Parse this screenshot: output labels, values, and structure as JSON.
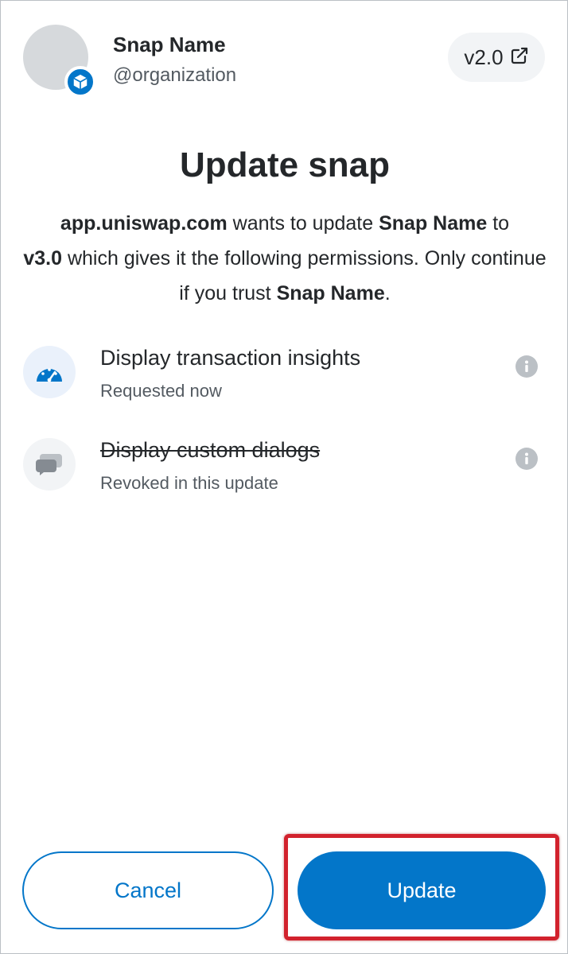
{
  "header": {
    "snap_name": "Snap Name",
    "organization": "@organization",
    "version": "v2.0",
    "version_icon": "external-link-icon",
    "badge_icon": "snap-box-icon"
  },
  "title": "Update snap",
  "description": {
    "origin": "app.uniswap.com",
    "part1": " wants to update ",
    "snap_name": "Snap Name",
    "part2": " to ",
    "new_version": "v3.0",
    "part3": " which gives it the following permissions. Only continue if you trust ",
    "snap_name_2": "Snap Name",
    "part4": "."
  },
  "permissions": [
    {
      "label": "Display transaction insights",
      "status": "Requested now",
      "icon": "gauge-icon",
      "revoked": false
    },
    {
      "label": "Display custom dialogs",
      "status": "Revoked in this update",
      "icon": "chat-bubbles-icon",
      "revoked": true
    }
  ],
  "footer": {
    "cancel_label": "Cancel",
    "update_label": "Update"
  },
  "colors": {
    "primary": "#0376c9",
    "text": "#24272a",
    "muted": "#535a61",
    "highlight": "#d2222d"
  }
}
